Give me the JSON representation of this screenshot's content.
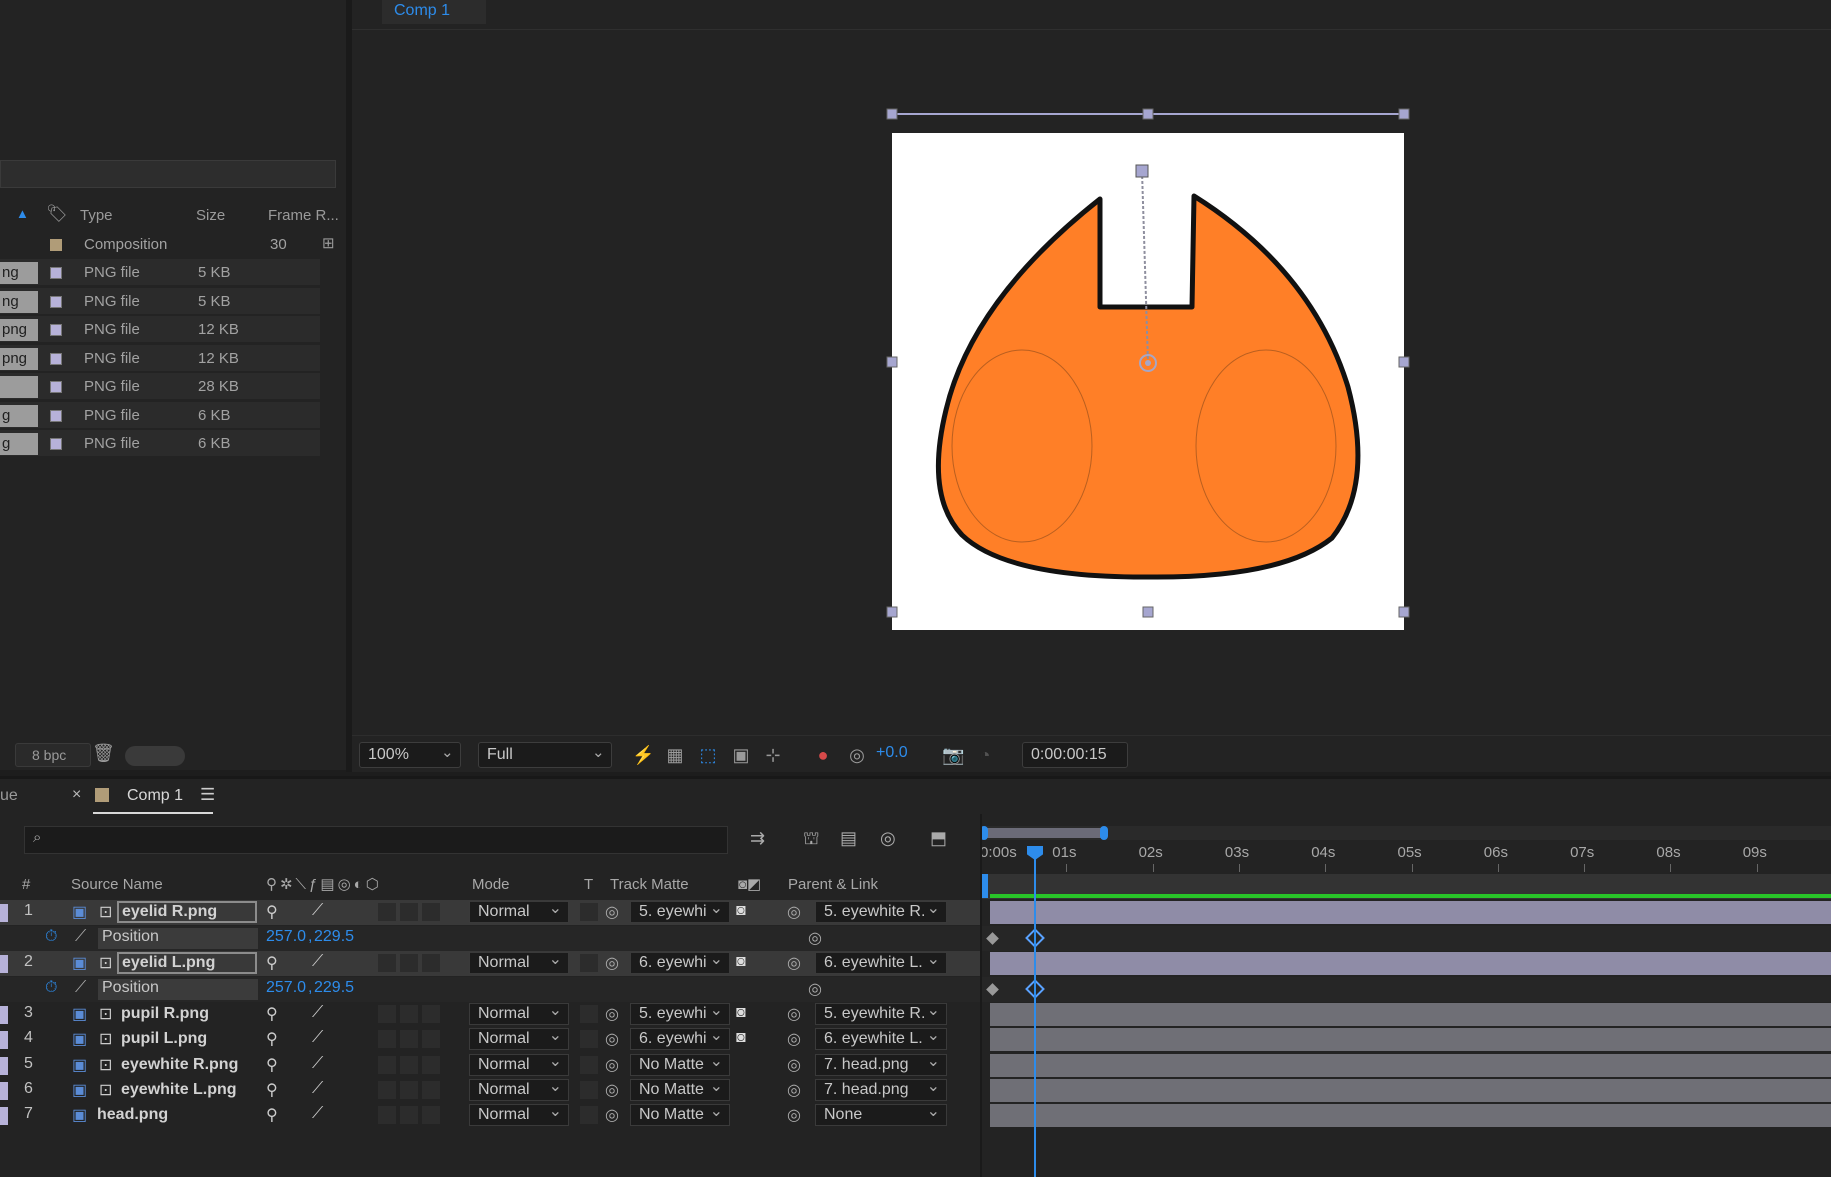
{
  "viewer": {
    "tab": "Comp 1",
    "zoom": "100%",
    "resolution": "Full",
    "exposure": "+0.0",
    "timecode": "0:00:00:15"
  },
  "project": {
    "columns": {
      "type": "Type",
      "size": "Size",
      "frame_rate": "Frame R..."
    },
    "composition": {
      "type": "Composition",
      "frame_rate": "30"
    },
    "items": [
      {
        "name": "ng",
        "type": "PNG file",
        "size": "5 KB"
      },
      {
        "name": "ng",
        "type": "PNG file",
        "size": "5 KB"
      },
      {
        "name": "png",
        "type": "PNG file",
        "size": "12 KB"
      },
      {
        "name": "png",
        "type": "PNG file",
        "size": "12 KB"
      },
      {
        "name": "",
        "type": "PNG file",
        "size": "28 KB"
      },
      {
        "name": "g",
        "type": "PNG file",
        "size": "6 KB"
      },
      {
        "name": "g",
        "type": "PNG file",
        "size": "6 KB"
      }
    ],
    "bpc": "8 bpc"
  },
  "timeline": {
    "left_tab_partial": "ue",
    "tab": "Comp 1",
    "headers": {
      "num": "#",
      "source": "Source Name",
      "mode": "Mode",
      "t": "T",
      "track_matte": "Track Matte",
      "parent": "Parent & Link"
    },
    "position_label": "Position",
    "position_x": "257.0",
    "position_y": "229.5",
    "layers": [
      {
        "num": "1",
        "name": "eyelid R.png",
        "mode": "Normal",
        "matte": "5. eyewhi",
        "parent": "5. eyewhite R."
      },
      {
        "num": "2",
        "name": "eyelid L.png",
        "mode": "Normal",
        "matte": "6. eyewhi",
        "parent": "6. eyewhite L."
      },
      {
        "num": "3",
        "name": "pupil R.png",
        "mode": "Normal",
        "matte": "5. eyewhi",
        "parent": "5. eyewhite R."
      },
      {
        "num": "4",
        "name": "pupil L.png",
        "mode": "Normal",
        "matte": "6. eyewhi",
        "parent": "6. eyewhite L."
      },
      {
        "num": "5",
        "name": "eyewhite R.png",
        "mode": "Normal",
        "matte": "No Matte",
        "parent": "7. head.png"
      },
      {
        "num": "6",
        "name": "eyewhite L.png",
        "mode": "Normal",
        "matte": "No Matte",
        "parent": "7. head.png"
      },
      {
        "num": "7",
        "name": "head.png",
        "mode": "Normal",
        "matte": "No Matte",
        "parent": "None"
      }
    ],
    "ruler": [
      "0:00s",
      "01s",
      "02s",
      "03s",
      "04s",
      "05s",
      "06s",
      "07s",
      "08s",
      "09s"
    ]
  },
  "colors": {
    "accent": "#2d8ceb",
    "shape_fill": "#ff7f27",
    "layer_bar": "#8f8ca7"
  }
}
